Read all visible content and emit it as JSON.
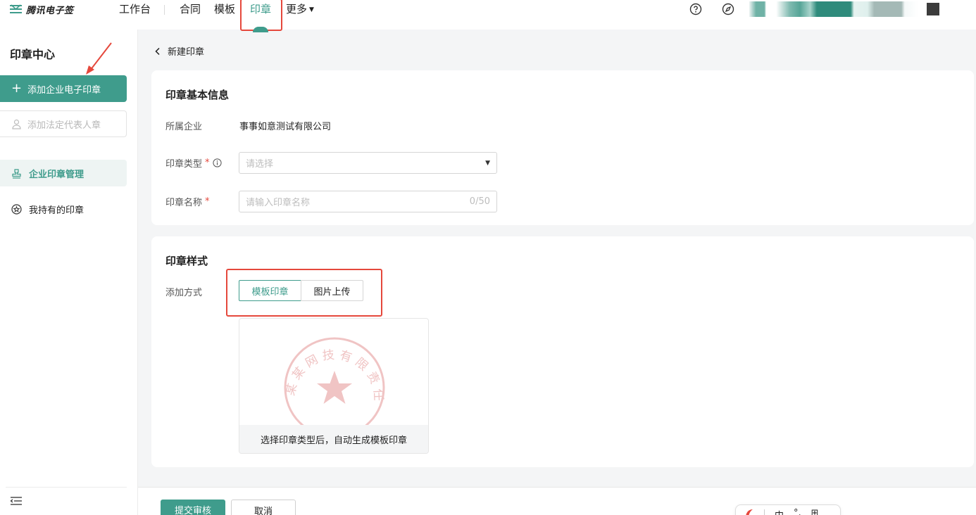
{
  "topnav": {
    "logo_text": "腾讯电子签",
    "items": [
      "工作台",
      "合同",
      "模板",
      "印章",
      "更多"
    ],
    "active_item": "印章",
    "more_caret": "▼"
  },
  "sidebar": {
    "title": "印章中心",
    "add_seal_button": "添加企业电子印章",
    "add_legal_button": "添加法定代表人章",
    "items": [
      {
        "label": "企业印章管理",
        "active": true
      },
      {
        "label": "我持有的印章",
        "active": false
      }
    ]
  },
  "breadcrumb": {
    "back_label": "新建印章"
  },
  "basic_info": {
    "title": "印章基本信息",
    "company_label": "所属企业",
    "company_value": "事事如意测试有限公司",
    "type_label": "印章类型",
    "type_placeholder": "请选择",
    "name_label": "印章名称",
    "name_placeholder": "请输入印章名称",
    "name_counter": "0/50",
    "required_mark": "*"
  },
  "seal_style": {
    "title": "印章样式",
    "method_label": "添加方式",
    "options": [
      "模板印章",
      "图片上传"
    ],
    "selected_option": "模板印章",
    "preview_caption": "选择印章类型后，自动生成模板印章",
    "preview_stamp_text": "某某网技有限责任公司"
  },
  "footer": {
    "submit_button": "提交审核",
    "cancel_button": "取消",
    "ime_char": "中"
  },
  "colors": {
    "brand": "#3f9c8c",
    "highlight_annotation": "#e5483c",
    "stamp_watermark": "#f0c4c4"
  }
}
